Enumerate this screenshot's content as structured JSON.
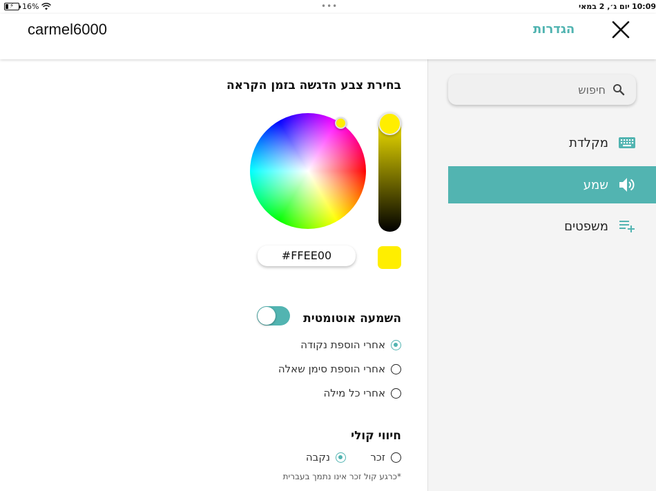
{
  "status_bar": {
    "battery": "16%",
    "date": "יום ג׳, 2 במאי",
    "time": "10:09"
  },
  "header": {
    "username": "carmel6000",
    "title": "הגדרות"
  },
  "sidebar": {
    "search_placeholder": "חיפוש",
    "items": [
      {
        "label": "מקלדת",
        "icon": "keyboard-icon",
        "active": false
      },
      {
        "label": "שמע",
        "icon": "speaker-icon",
        "active": true
      },
      {
        "label": "משפטים",
        "icon": "playlist-add-icon",
        "active": false
      }
    ]
  },
  "highlight": {
    "title": "בחירת צבע הדגשה בזמן הקראה",
    "hex": "#FFEE00",
    "color": "#FFEE00"
  },
  "auto_play": {
    "title": "השמעה אוטומטית",
    "enabled": true,
    "options": [
      {
        "label": "אחרי הוספת נקודה",
        "checked": true
      },
      {
        "label": "אחרי הוספת סימן שאלה",
        "checked": false
      },
      {
        "label": "אחרי כל מילה",
        "checked": false
      }
    ]
  },
  "voice_feedback": {
    "title": "חיווי קולי",
    "options": [
      {
        "label": "זכר",
        "checked": false
      },
      {
        "label": "נקבה",
        "checked": true
      }
    ],
    "note": "*כרגע קול זכר אינו נתמך בעברית"
  },
  "colors": {
    "accent": "#52b4b1",
    "header_title": "#4fb3b0",
    "sidebar_bg": "#f4f4f4"
  }
}
